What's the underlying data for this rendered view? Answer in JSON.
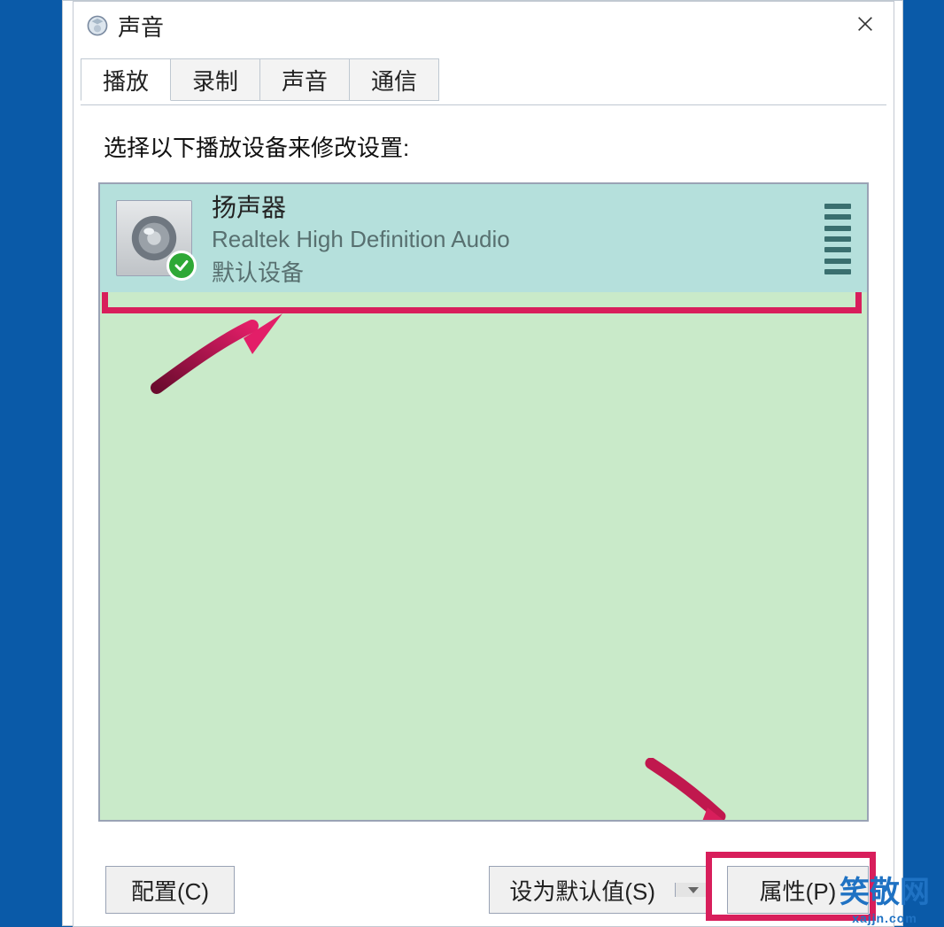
{
  "window": {
    "title": "声音"
  },
  "tabs": {
    "playback": "播放",
    "recording": "录制",
    "sounds": "声音",
    "communications": "通信"
  },
  "main": {
    "instruction": "选择以下播放设备来修改设置:"
  },
  "device": {
    "name": "扬声器",
    "driver": "Realtek High Definition Audio",
    "status": "默认设备"
  },
  "buttons": {
    "configure": "配置(C)",
    "set_default": "设为默认值(S)",
    "properties": "属性(P)"
  },
  "watermark": {
    "brand": "笑敬网",
    "url": "xajjn.com"
  }
}
